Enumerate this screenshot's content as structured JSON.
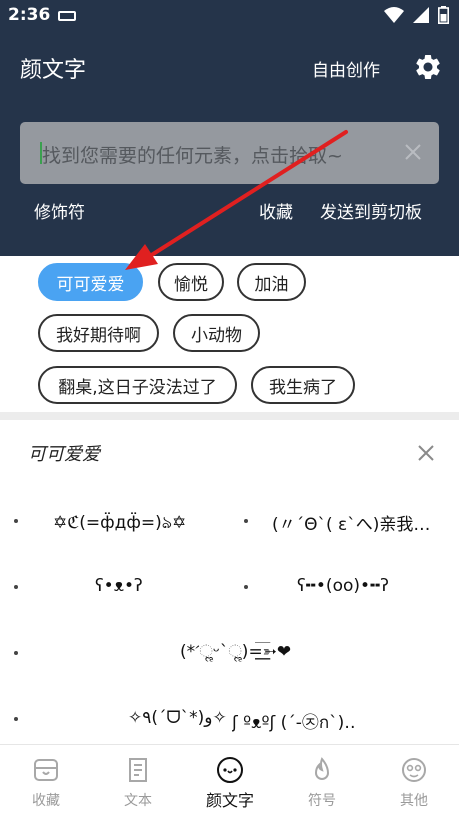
{
  "status": {
    "time": "2:36"
  },
  "header": {
    "title": "颜文字",
    "free_create": "自由创作",
    "search_placeholder": "找到您需要的任何元素，点击拾取~",
    "actions": {
      "decorate": "修饰符",
      "favorite": "收藏",
      "send": "发送到剪切板"
    }
  },
  "tags": [
    "可可爱爱",
    "愉悦",
    "加油",
    "我好期待啊",
    "小动物",
    "翻桌,这日子没法过了",
    "我生病了"
  ],
  "section": {
    "title": "可可爱爱"
  },
  "emoticons": [
    "✡ℭ(=ф̈дф̈=)ঌ✡",
    "(〃´Θ`( ε`へ)亲我…",
    "ʕ•ᴥ•ʔ",
    "ʕ╍•(oo)•╍ʔ",
    "(*ˊૢᵕˋૢ)=͟͟͞͞➳❤",
    "✧٩(ˊᗜˋ*)و✧",
    "ʃ ºᴥºʃ (´-㉨ก`)…"
  ],
  "nav": [
    {
      "label": "收藏",
      "icon": "favorites-box-icon"
    },
    {
      "label": "文本",
      "icon": "document-icon"
    },
    {
      "label": "颜文字",
      "icon": "emoticon-face-icon"
    },
    {
      "label": "符号",
      "icon": "flame-icon"
    },
    {
      "label": "其他",
      "icon": "other-face-icon"
    }
  ],
  "colors": {
    "header_bg": "#25344a",
    "accent": "#4aa3f2",
    "annotation": "#e02020"
  }
}
